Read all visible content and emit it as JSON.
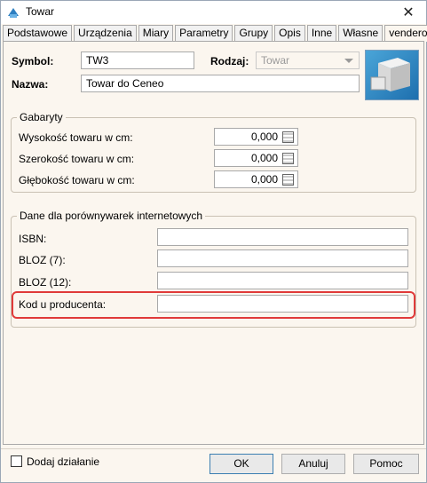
{
  "window": {
    "title": "Towar",
    "close_label": "✕"
  },
  "tabs": [
    {
      "label": "Podstawowe"
    },
    {
      "label": "Urządzenia"
    },
    {
      "label": "Miary"
    },
    {
      "label": "Parametry"
    },
    {
      "label": "Grupy"
    },
    {
      "label": "Opis"
    },
    {
      "label": "Inne"
    },
    {
      "label": "Własne"
    },
    {
      "label": "vendero"
    }
  ],
  "header": {
    "symbol_label": "Symbol:",
    "symbol_value": "TW3",
    "rodzaj_label": "Rodzaj:",
    "rodzaj_value": "Towar",
    "nazwa_label": "Nazwa:",
    "nazwa_value": "Towar do Ceneo"
  },
  "gabaryty": {
    "legend": "Gabaryty",
    "rows": [
      {
        "label": "Wysokość towaru w cm:",
        "value": "0,000"
      },
      {
        "label": "Szerokość towaru w cm:",
        "value": "0,000"
      },
      {
        "label": "Głębokość towaru w cm:",
        "value": "0,000"
      }
    ]
  },
  "porownywarki": {
    "legend": "Dane dla porównywarek internetowych",
    "fields": [
      {
        "label": "ISBN:",
        "value": ""
      },
      {
        "label": "BLOZ (7):",
        "value": ""
      },
      {
        "label": "BLOZ (12):",
        "value": ""
      },
      {
        "label": "Kod u producenta:",
        "value": ""
      }
    ]
  },
  "footer": {
    "dodaj_label": "Dodaj działanie",
    "ok_label": "OK",
    "anuluj_label": "Anuluj",
    "pomoc_label": "Pomoc"
  },
  "colors": {
    "highlight": "#e03a3a",
    "panel": "#fbf6ef"
  }
}
